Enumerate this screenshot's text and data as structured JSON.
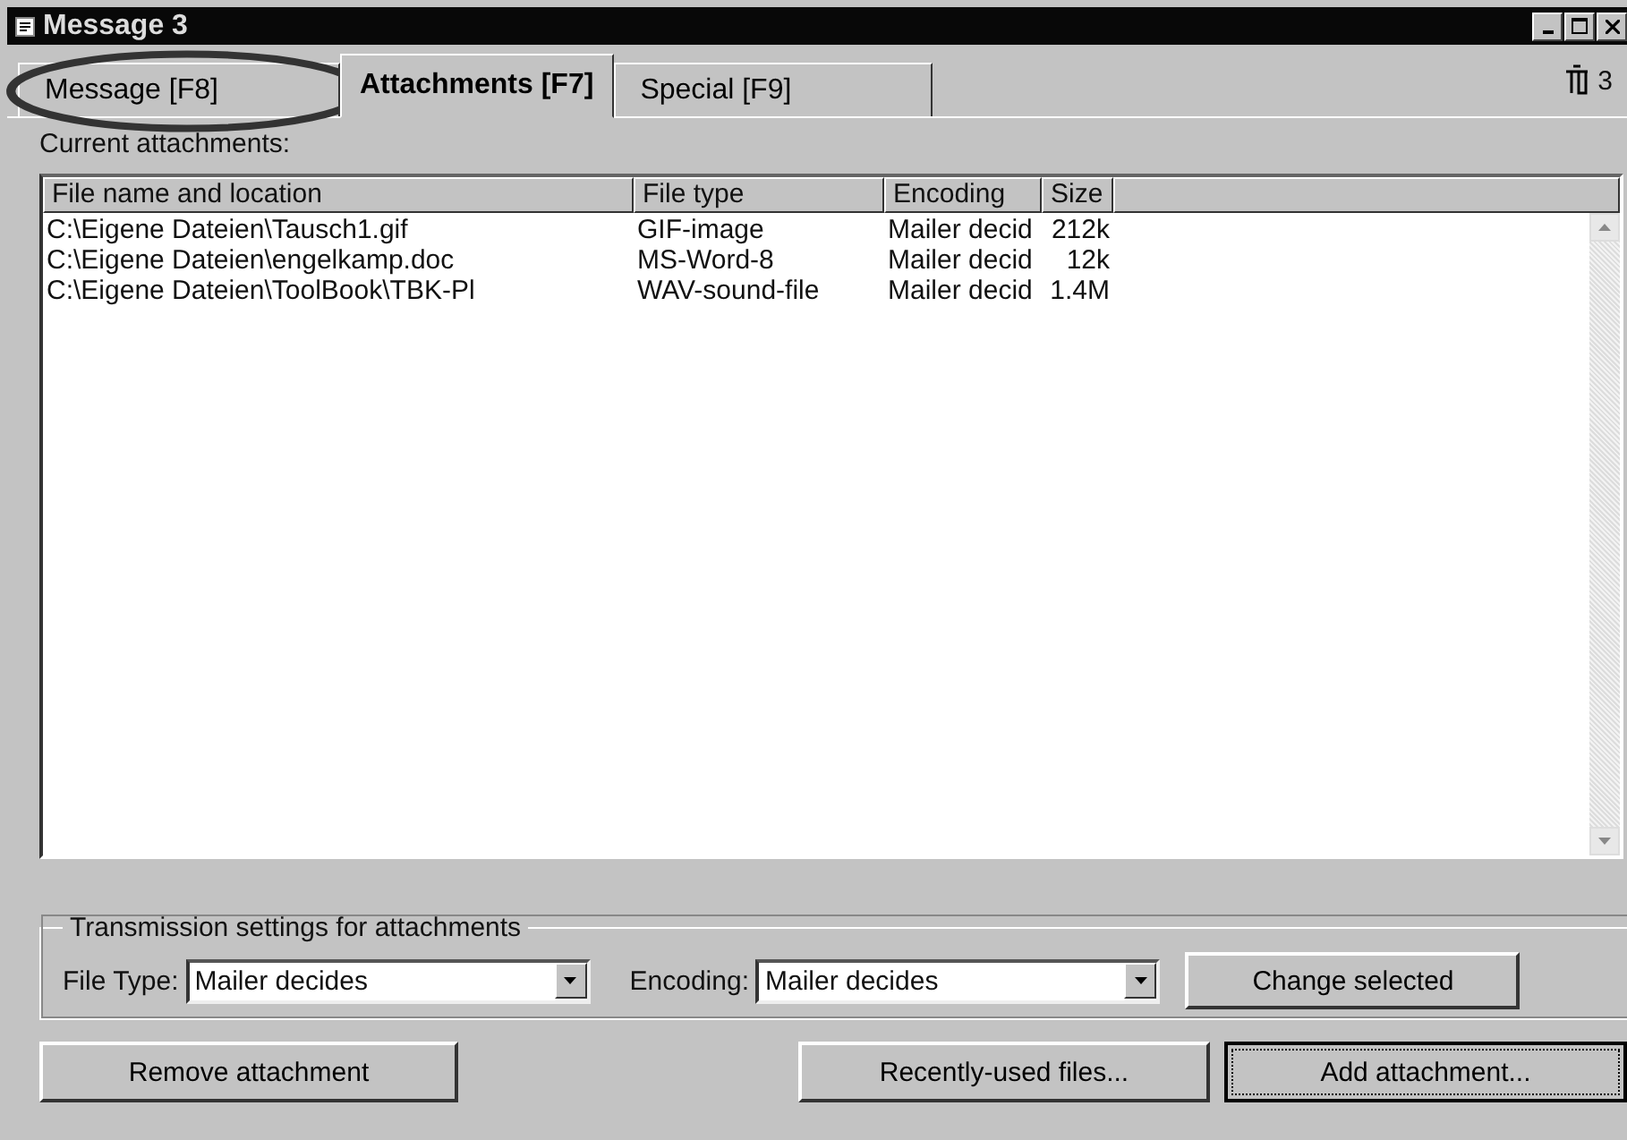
{
  "window": {
    "title": "Message 3"
  },
  "tabs": [
    {
      "label": "Message  [F8]",
      "selected": false,
      "circled": true
    },
    {
      "label": "Attachments  [F7]",
      "selected": true,
      "circled": false
    },
    {
      "label": "Special  [F9]",
      "selected": false,
      "circled": false
    }
  ],
  "attachment_count": "3",
  "list_label": "Current attachments:",
  "table": {
    "columns": [
      "File name and location",
      "File type",
      "Encoding",
      "Size"
    ],
    "rows": [
      [
        "C:\\Eigene Dateien\\Tausch1.gif",
        "GIF-image",
        "Mailer decid",
        "212k"
      ],
      [
        "C:\\Eigene Dateien\\engelkamp.doc",
        "MS-Word-8",
        "Mailer decid",
        "12k"
      ],
      [
        "C:\\Eigene Dateien\\ToolBook\\TBK-Pl",
        "WAV-sound-file",
        "Mailer decid",
        "1.4M"
      ]
    ]
  },
  "transmission": {
    "title": "Transmission settings for attachments",
    "file_type_label": "File Type:",
    "file_type": "Mailer decides",
    "encoding_label": "Encoding:",
    "encoding": "Mailer decides",
    "button": "Change selected"
  },
  "buttons": [
    {
      "label": "Remove attachment",
      "focused": false
    },
    {
      "label": "Recently-used files...",
      "focused": false
    },
    {
      "label": "Add attachment...",
      "focused": true
    }
  ]
}
